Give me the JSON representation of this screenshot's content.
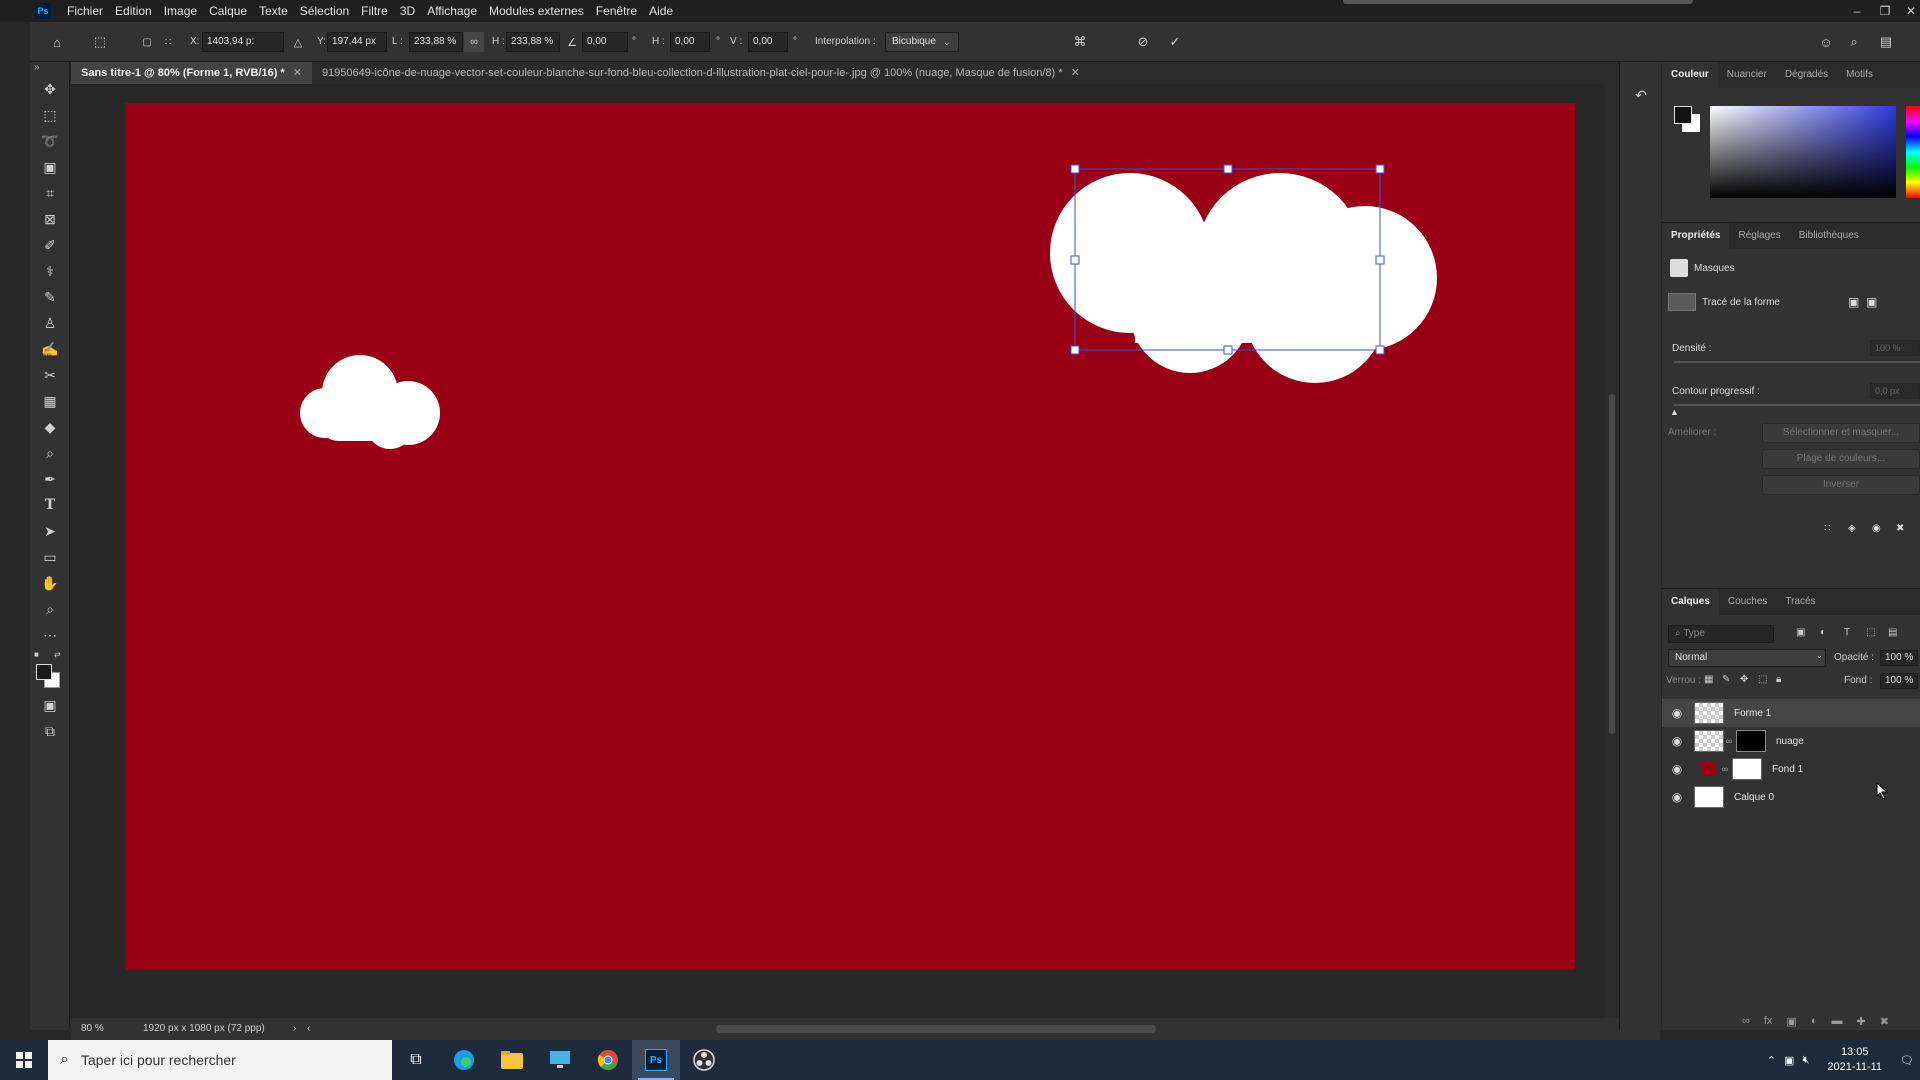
{
  "menubar": {
    "logo": "Ps",
    "items": [
      "Fichier",
      "Edition",
      "Image",
      "Calque",
      "Texte",
      "Sélection",
      "Filtre",
      "3D",
      "Affichage",
      "Modules externes",
      "Fenêtre",
      "Aide"
    ]
  },
  "options": {
    "x_label": "X:",
    "x_value": "1403,94 p:",
    "y_label": "Y:",
    "y_value": "197,44 px",
    "w_label": "L :",
    "w_value": "233,88 %",
    "h_label": "H :",
    "h_value": "233,88 %",
    "angle_value": "0,00",
    "hskew_label": "H :",
    "hskew_value": "0,00",
    "vskew_label": "V :",
    "vskew_value": "0,00",
    "interp_label": "Interpolation :",
    "interp_value": "Bicubique"
  },
  "tabs": [
    {
      "label": "Sans titre-1 @ 80% (Forme 1, RVB/16) *",
      "active": true
    },
    {
      "label": "91950649-icône-de-nuage-vector-set-couleur-blanche-sur-fond-bleu-collection-d-illustration-plat-ciel-pour-le-.jpg @ 100% (nuage, Masque de fusion/8) *",
      "active": false
    }
  ],
  "status": {
    "zoom": "80 %",
    "doc_info": "1920 px x 1080 px (72 ppp)"
  },
  "canvas": {
    "background_color": "#990016",
    "cloud_color": "#ffffff",
    "selection_color": "#3a4fd6"
  },
  "color_panel": {
    "tabs": [
      "Couleur",
      "Nuancier",
      "Dégradés",
      "Motifs"
    ]
  },
  "properties_panel": {
    "tabs": [
      "Propriétés",
      "Réglages",
      "Bibliothèques"
    ],
    "masks_label": "Masques",
    "shape_path_label": "Tracé de la forme",
    "density_label": "Densité :",
    "density_value": "100 %",
    "feather_label": "Contour progressif :",
    "feather_value": "0,0 px",
    "refine_label": "Améliorer :",
    "select_mask_btn": "Sélectionner et masquer...",
    "color_range_btn": "Plage de couleurs...",
    "invert_btn": "Inverser"
  },
  "layers_panel": {
    "tabs": [
      "Calques",
      "Couches",
      "Tracés"
    ],
    "filter_placeholder": "Type",
    "blend_mode": "Normal",
    "opacity_label": "Opacité :",
    "opacity_value": "100 %",
    "lock_label": "Verrou :",
    "fill_label": "Fond :",
    "fill_value": "100 %",
    "layers": [
      {
        "name": "Forme 1",
        "selected": true
      },
      {
        "name": "nuage",
        "selected": false
      },
      {
        "name": "Fond 1",
        "selected": false
      },
      {
        "name": "Calque 0",
        "selected": false
      }
    ]
  },
  "taskbar": {
    "search_placeholder": "Taper ici pour rechercher",
    "time": "13:05",
    "date": "2021-11-11"
  }
}
